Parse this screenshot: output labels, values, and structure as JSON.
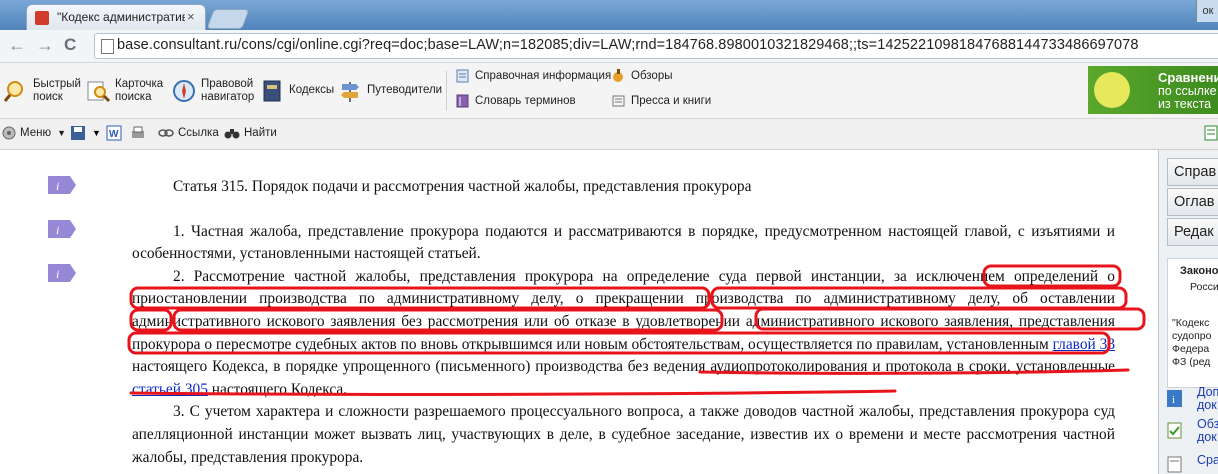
{
  "browser": {
    "tab_title": "\"Кодекс административнс",
    "tab_close": "×",
    "window_control": "ок",
    "back": "←",
    "forward": "→",
    "reload": "C",
    "url": "base.consultant.ru/cons/cgi/online.cgi?req=doc;base=LAW;n=182085;div=LAW;rnd=184768.8980010321829468;;ts=1425221098184768814473348669707​8"
  },
  "toolbar1": {
    "items": [
      {
        "label1": "Быстрый",
        "label2": "поиск",
        "icon": "quick-search-icon"
      },
      {
        "label1": "Карточка",
        "label2": "поиска",
        "icon": "search-card-icon"
      },
      {
        "label1": "Правовой",
        "label2": "навигатор",
        "icon": "legal-navigator-icon"
      },
      {
        "label1": "Кодексы",
        "label2": "",
        "icon": "codes-icon"
      },
      {
        "label1": "Путеводители",
        "label2": "",
        "icon": "guides-icon"
      }
    ],
    "small_items": [
      "Справочная информация",
      "Словарь терминов",
      "Обзоры",
      "Пресса и книги"
    ],
    "banner": {
      "line1": "Сравнени",
      "line2": "по ссылке",
      "line3": "из текста"
    }
  },
  "toolbar2": {
    "menu": "Меню",
    "link": "Ссылка",
    "find": "Найти"
  },
  "document": {
    "title": "Статья 315. Порядок подачи и рассмотрения частной жалобы, представления прокурора",
    "p1": "1. Частная жалоба, представление прокурора подаются и рассматриваются в порядке, предусмотренном настоящей главой, с изъятиями и особенностями, установленными настоящей статьей.",
    "p2_a": "2. Рассмотрение частной жалобы, представления прокурора на определение суда первой инстанции, за исключением определений о приостановлении производства по административному делу, о прекращении производства по административному делу, об оставлении административного искового заявления без рассмотрения или об отказе в удовлетворении административного искового заявления, представления прокурора о пересмотре судебных актов по вновь открывшимся или новым обстоятельствам, осуществляется по правилам, установленным ",
    "p2_link1": "главой 33",
    "p2_b": " настоящего Кодекса, в порядке упрощенного (письменного) производства без ведения аудиопротоколирования и протокола в сроки, установленные ",
    "p2_link2": "статьей 305",
    "p2_c": " настоящего Кодекса.",
    "p3": "3. С учетом характера и сложности разрешаемого процессуального вопроса, а также доводов частной жалобы, представления прокурора суд апелляционной инстанции может вызвать лиц, участвующих в деле, в судебное заседание, известив их о времени и месте рассмотрения частной жалобы, представления прокурора."
  },
  "right_panel": {
    "tabs": [
      "Справ",
      "Оглав",
      "Редак"
    ],
    "info_title": "Законо",
    "info_sub": "Росси",
    "info_lines": [
      "\"Кодекс",
      "судопро",
      "Федера",
      "ФЗ (ред"
    ],
    "links": [
      {
        "line1": "Доп",
        "line2": "док"
      },
      {
        "line1": "Обз",
        "line2": "док"
      },
      {
        "line1": "Сра",
        "line2": ""
      }
    ]
  },
  "colors": {
    "annotation": "#e8141b",
    "link": "#0b28c8",
    "info_icon": "#8e7fd0"
  }
}
